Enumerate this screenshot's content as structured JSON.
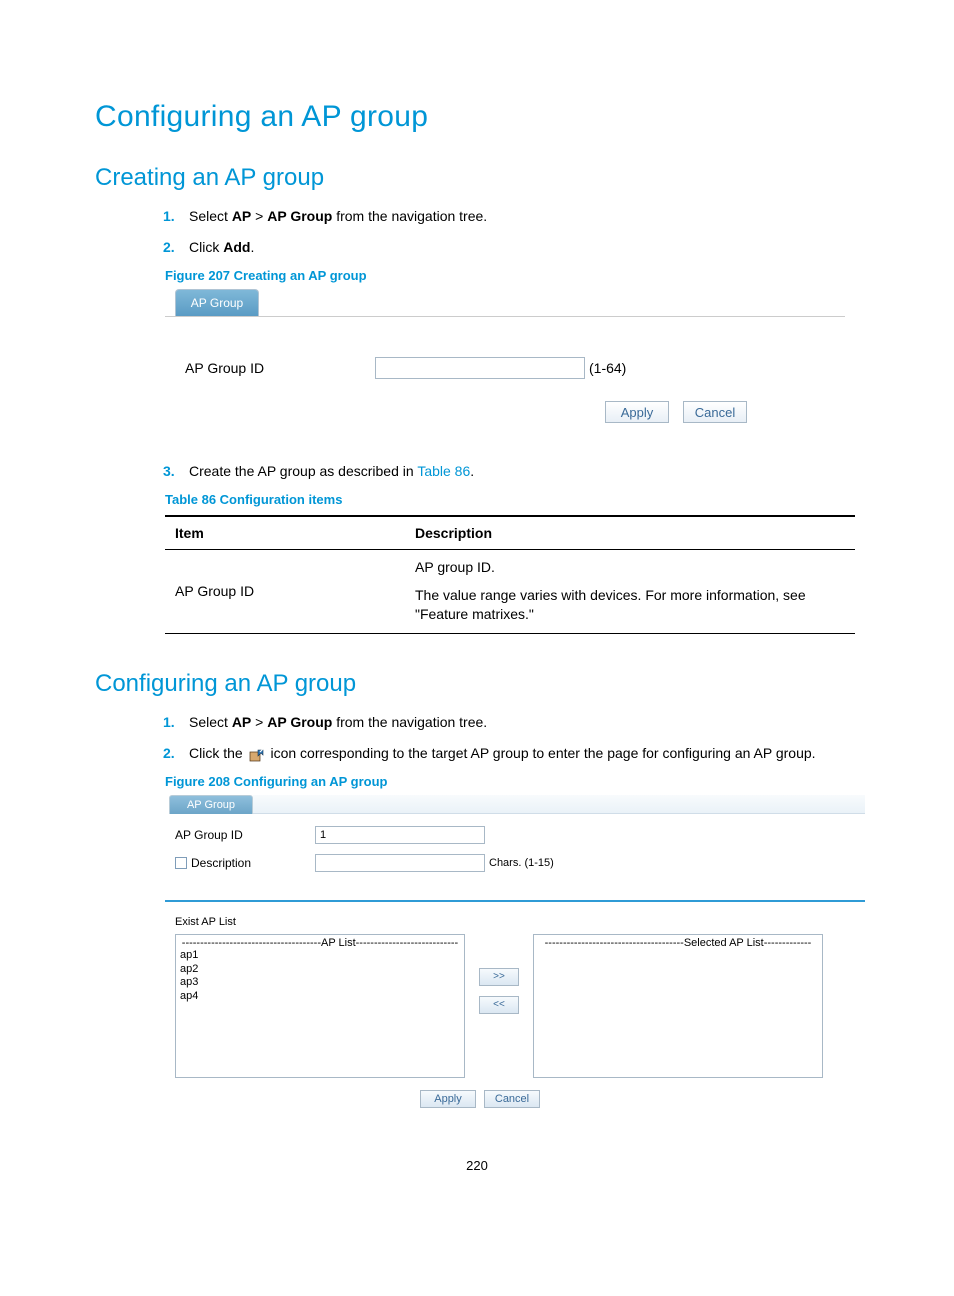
{
  "page_number": "220",
  "main_title": "Configuring an AP group",
  "section1": {
    "title": "Creating an AP group",
    "steps": {
      "s1a": "Select ",
      "s1b_bold": "AP",
      "s1c": " > ",
      "s1d_bold": "AP Group",
      "s1e": " from the navigation tree.",
      "s2a": "Click ",
      "s2b_bold": "Add",
      "s2c": ".",
      "s3a": "Create the AP group as described in ",
      "s3b_link": "Table 86",
      "s3c": "."
    },
    "fig207_caption": "Figure 207 Creating an AP group",
    "fig207": {
      "tab_label": "AP Group",
      "field_label": "AP Group ID",
      "field_value": "",
      "hint": "(1-64)",
      "apply": "Apply",
      "cancel": "Cancel"
    },
    "tbl86_caption": "Table 86 Configuration items",
    "tbl86": {
      "headers": {
        "item": "Item",
        "desc": "Description"
      },
      "row1": {
        "item": "AP Group ID",
        "desc_line1": "AP group ID.",
        "desc_line2": "The value range varies with devices. For more information, see \"Feature matrixes.\""
      }
    }
  },
  "section2": {
    "title": "Configuring an AP group",
    "steps": {
      "s1a": "Select ",
      "s1b_bold": "AP",
      "s1c": " > ",
      "s1d_bold": "AP Group",
      "s1e": " from the navigation tree.",
      "s2a": "Click the ",
      "s2b": " icon corresponding to the target AP group to enter the page for configuring an AP group."
    },
    "fig208_caption": "Figure 208 Configuring an AP group",
    "fig208": {
      "tab_label": "AP Group",
      "groupid_label": "AP Group ID",
      "groupid_value": "1",
      "desc_label": "Description",
      "desc_value": "",
      "desc_hint": "Chars. (1-15)",
      "exist_label": "Exist AP List",
      "aplist_header": "--------------------------------------AP List----------------------------",
      "selected_header": "--------------------------------------Selected AP List-------------",
      "ap_items": [
        "ap1",
        "ap2",
        "ap3",
        "ap4"
      ],
      "move_right": ">>",
      "move_left": "<<",
      "apply": "Apply",
      "cancel": "Cancel"
    }
  }
}
